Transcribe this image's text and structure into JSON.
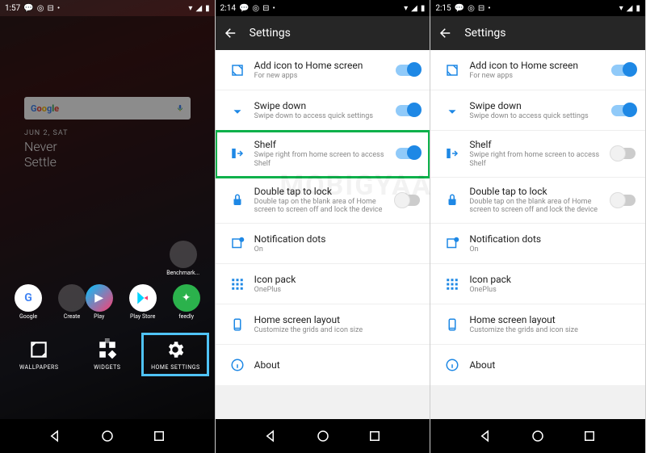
{
  "watermark": "MOBIGYAAN",
  "phone1": {
    "time": "1:57",
    "search_label": "Google",
    "date": "JUN 2, SAT",
    "slogan_line1": "Never",
    "slogan_line2": "Settle",
    "bench_label": "Benchmark...",
    "icons": {
      "google": "Google",
      "create": "Create",
      "play": "Play",
      "playstore": "Play Store",
      "feedly": "feedly"
    },
    "actions": {
      "wallpapers": "WALLPAPERS",
      "widgets": "WIDGETS",
      "homesettings": "HOME SETTINGS"
    }
  },
  "settings": {
    "title": "Settings",
    "items": [
      {
        "key": "addicon",
        "title": "Add icon to Home screen",
        "sub": "For new apps",
        "toggle": "on"
      },
      {
        "key": "swipedown",
        "title": "Swipe down",
        "sub": "Swipe down to access quick settings",
        "toggle": "on"
      },
      {
        "key": "shelf",
        "title": "Shelf",
        "sub": "Swipe right from home screen to access Shelf",
        "toggle": "on"
      },
      {
        "key": "doubletap",
        "title": "Double tap to lock",
        "sub": "Double tap on the blank area of Home screen to screen off and lock the device",
        "toggle": "off"
      },
      {
        "key": "notifdots",
        "title": "Notification dots",
        "sub": "On",
        "toggle": null
      },
      {
        "key": "iconpack",
        "title": "Icon pack",
        "sub": "OnePlus",
        "toggle": null
      },
      {
        "key": "homelayout",
        "title": "Home screen layout",
        "sub": "Customize the grids and icon size",
        "toggle": null
      },
      {
        "key": "about",
        "title": "About",
        "sub": "",
        "toggle": null
      }
    ]
  },
  "phone2": {
    "time": "2:14",
    "shelf_highlight": true,
    "shelf_toggle": "on"
  },
  "phone3": {
    "time": "2:15",
    "shelf_highlight": false,
    "shelf_toggle": "off"
  }
}
